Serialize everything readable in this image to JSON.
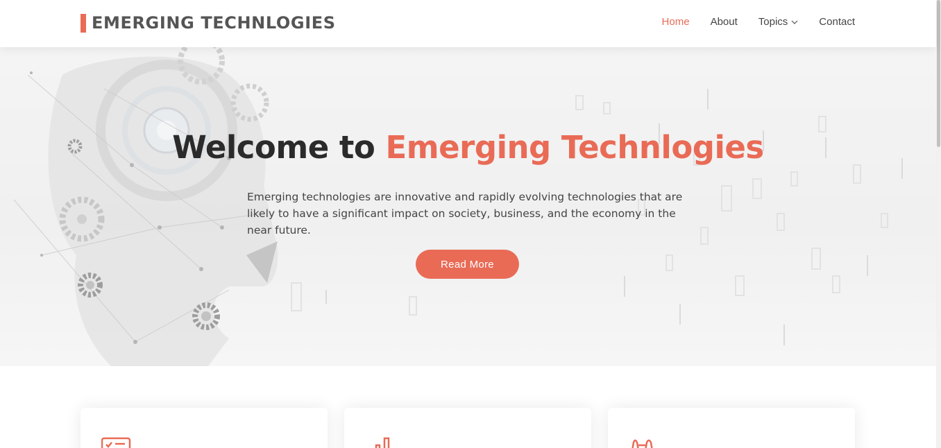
{
  "colors": {
    "accent": "#e96b56",
    "text": "#444444",
    "heading": "#2b2b2b"
  },
  "header": {
    "logo_text": "EMERGING TECHNLOGIES",
    "nav": [
      {
        "label": "Home",
        "active": true
      },
      {
        "label": "About",
        "active": false
      },
      {
        "label": "Topics",
        "active": false,
        "icon": "chevron-down-icon"
      },
      {
        "label": "Contact",
        "active": false
      }
    ]
  },
  "hero": {
    "title_prefix": "Welcome to ",
    "title_highlight": "Emerging Technlogies",
    "description": "Emerging technologies are innovative and rapidly evolving technologies that are likely to have a significant impact on society, business, and the economy in the near future.",
    "button_label": "Read More",
    "background": "gears-and-circuit-head-illustration"
  },
  "cards": [
    {
      "icon": "checklist-icon"
    },
    {
      "icon": "bar-chart-icon"
    },
    {
      "icon": "binoculars-icon"
    }
  ]
}
